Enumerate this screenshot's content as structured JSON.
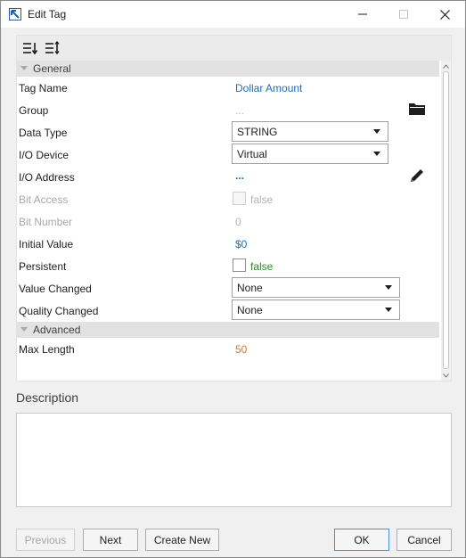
{
  "window": {
    "title": "Edit Tag",
    "icons": {
      "app": "app-logo-icon",
      "minimize": "minimize-icon",
      "maximize": "maximize-icon",
      "close": "close-icon"
    }
  },
  "toolbar": {
    "icons": [
      "sort-ascending-icon",
      "sort-custom-icon"
    ]
  },
  "sections": {
    "general": {
      "title": "General"
    },
    "advanced": {
      "title": "Advanced"
    }
  },
  "properties": {
    "tag_name": {
      "label": "Tag Name",
      "value": "Dollar Amount"
    },
    "group": {
      "label": "Group",
      "value": "..."
    },
    "data_type": {
      "label": "Data Type",
      "value": "STRING"
    },
    "io_device": {
      "label": "I/O Device",
      "value": "Virtual"
    },
    "io_address": {
      "label": "I/O Address",
      "value": "..."
    },
    "bit_access": {
      "label": "Bit Access",
      "value": "false"
    },
    "bit_number": {
      "label": "Bit Number",
      "value": "0"
    },
    "initial_value": {
      "label": "Initial Value",
      "value": "$0"
    },
    "persistent": {
      "label": "Persistent",
      "value": "false"
    },
    "value_changed": {
      "label": "Value Changed",
      "value": "None"
    },
    "quality_changed": {
      "label": "Quality Changed",
      "value": "None"
    },
    "max_length": {
      "label": "Max Length",
      "value": "50"
    }
  },
  "description": {
    "label": "Description",
    "value": ""
  },
  "buttons": {
    "previous": "Previous",
    "next": "Next",
    "create_new": "Create New",
    "ok": "OK",
    "cancel": "Cancel"
  },
  "colors": {
    "link_blue": "#1d6fb8",
    "value_green": "#2e8a2e",
    "value_orange": "#e0751e",
    "section_header": "#e2e2e2"
  }
}
